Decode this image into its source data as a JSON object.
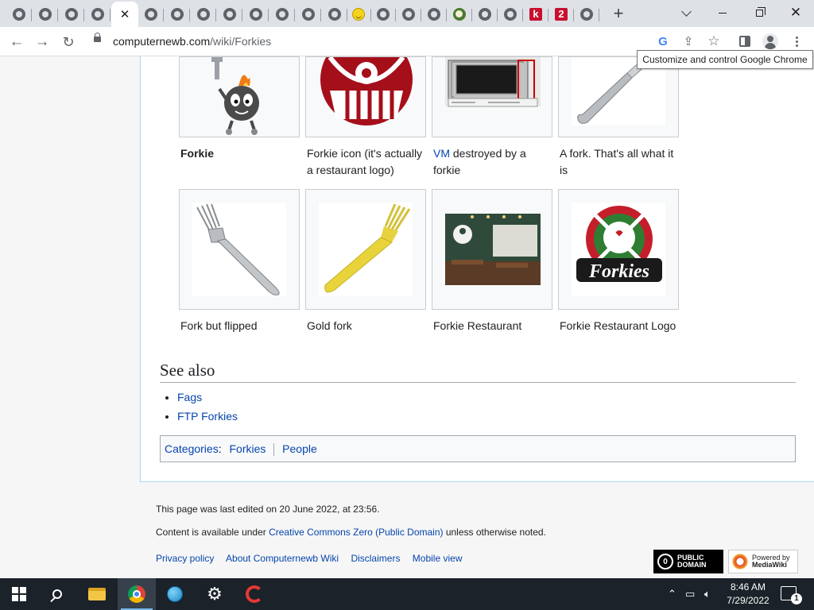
{
  "browser": {
    "tabs": [
      {
        "icon": "globe-icon"
      },
      {
        "icon": "globe-icon"
      },
      {
        "icon": "globe-icon"
      },
      {
        "icon": "globe-icon"
      },
      {
        "icon": "close-icon",
        "active": true
      },
      {
        "icon": "globe-icon"
      },
      {
        "icon": "globe-icon"
      },
      {
        "icon": "globe-icon"
      },
      {
        "icon": "globe-icon"
      },
      {
        "icon": "globe-icon"
      },
      {
        "icon": "globe-icon"
      },
      {
        "icon": "globe-icon"
      },
      {
        "icon": "globe-icon"
      },
      {
        "icon": "smiley-icon"
      },
      {
        "icon": "globe-icon"
      },
      {
        "icon": "globe-icon"
      },
      {
        "icon": "globe-icon"
      },
      {
        "icon": "leaf-icon"
      },
      {
        "icon": "globe-icon"
      },
      {
        "icon": "globe-icon"
      },
      {
        "icon": "letter-k-icon",
        "label": "k"
      },
      {
        "icon": "number-2-icon",
        "label": "2"
      },
      {
        "icon": "globe-icon"
      }
    ],
    "url_host": "computernewb.com",
    "url_path": "/wiki/Forkies",
    "tooltip": "Customize and control Google Chrome"
  },
  "gallery": {
    "row1": [
      {
        "caption_bold": "Forkie",
        "caption": ""
      },
      {
        "caption": "Forkie icon (it's actually a restaurant logo)"
      },
      {
        "link": "VM",
        "caption": " destroyed by a forkie"
      },
      {
        "caption": "A fork. That's all what it is"
      }
    ],
    "row2": [
      {
        "caption": "Fork but flipped"
      },
      {
        "caption": "Gold fork"
      },
      {
        "caption": "Forkie Restaurant"
      },
      {
        "caption": "Forkie Restaurant Logo"
      }
    ]
  },
  "see_also": {
    "heading": "See also",
    "items": [
      "Fags",
      "FTP Forkies"
    ]
  },
  "categories": {
    "label": "Categories",
    "colon": ":",
    "items": [
      "Forkies",
      "People"
    ]
  },
  "footer": {
    "last_edited": "This page was last edited on 20 June 2022, at 23:56.",
    "license_prefix": "Content is available under ",
    "license_link": "Creative Commons Zero (Public Domain)",
    "license_suffix": " unless otherwise noted.",
    "links": [
      "Privacy policy",
      "About Computernewb Wiki",
      "Disclaimers",
      "Mobile view"
    ],
    "badge_pd_line1": "PUBLIC",
    "badge_pd_line2": "DOMAIN",
    "badge_mw_line1": "Powered by",
    "badge_mw_line2": "MediaWiki"
  },
  "forkies_logo_text": "Forkies",
  "taskbar": {
    "time": "8:46 AM",
    "date": "7/29/2022",
    "notification_count": "1"
  },
  "colors": {
    "link": "#0645ad",
    "border": "#a7d7f9",
    "taskbar": "#1b2229"
  }
}
